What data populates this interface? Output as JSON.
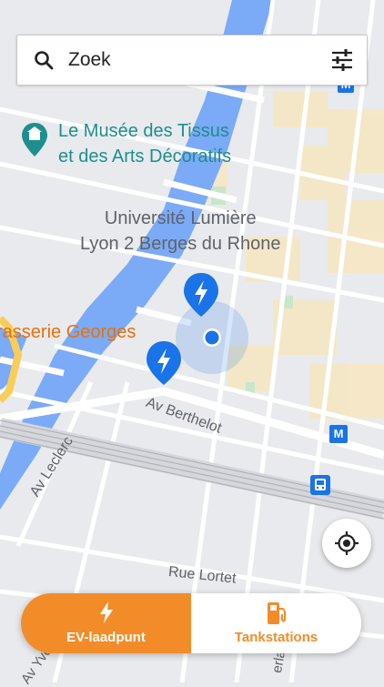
{
  "search": {
    "placeholder": "Zoek",
    "search_icon": "search-icon",
    "filter_icon": "filter-sliders-icon"
  },
  "map": {
    "poi_museum": [
      "Le Musée des Tissus",
      "et des Arts Décoratifs"
    ],
    "poi_university": [
      "Université Lumière",
      "Lyon 2 Berges du Rhone"
    ],
    "poi_brasserie": "rasserie Georges",
    "streets": {
      "berthelot": "Av Berthelot",
      "leclerc": "Av Leclerc",
      "lortet": "Rue Lortet",
      "yvon": "Av Yvo",
      "gerland": "erlan"
    },
    "metro_badge": "M",
    "colors": {
      "water": "#7baaf7",
      "road": "#ffffff",
      "land": "#e8eaed",
      "park": "#c8e6c9",
      "building": "#f6e7c3",
      "user_location": "#1a73e8",
      "charger_pin": "#1a73e8"
    }
  },
  "tabs": {
    "ev": {
      "label": "EV-laadpunt",
      "icon": "lightning-bolt-icon",
      "active": true
    },
    "fuel": {
      "label": "Tankstations",
      "icon": "fuel-pump-icon",
      "active": false
    }
  },
  "accent": "#f28c28",
  "my_location_icon": "crosshair-location-icon"
}
